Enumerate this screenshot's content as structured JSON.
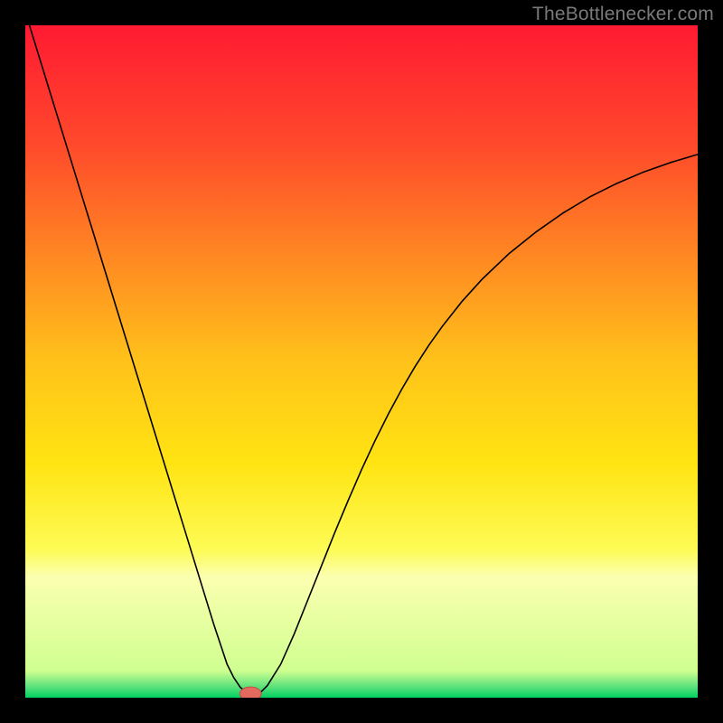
{
  "watermark": "TheBottlenecker.com",
  "chart_data": {
    "type": "line",
    "title": "",
    "xlabel": "",
    "ylabel": "",
    "xlim": [
      0,
      100
    ],
    "ylim": [
      0,
      100
    ],
    "grid": false,
    "legend": false,
    "background": {
      "type": "vertical-gradient",
      "stops": [
        {
          "offset": 0.0,
          "color": "#ff1a32"
        },
        {
          "offset": 0.18,
          "color": "#ff4a2b"
        },
        {
          "offset": 0.35,
          "color": "#ff8a22"
        },
        {
          "offset": 0.5,
          "color": "#ffc21a"
        },
        {
          "offset": 0.65,
          "color": "#ffe412"
        },
        {
          "offset": 0.78,
          "color": "#fdfb55"
        },
        {
          "offset": 0.82,
          "color": "#fbffb0"
        },
        {
          "offset": 0.96,
          "color": "#d0ff90"
        },
        {
          "offset": 0.985,
          "color": "#55e07a"
        },
        {
          "offset": 1.0,
          "color": "#00d060"
        }
      ]
    },
    "series": [
      {
        "name": "bottleneck-curve",
        "color": "#000000",
        "x": [
          0,
          2,
          4,
          6,
          8,
          10,
          12,
          14,
          16,
          18,
          20,
          22,
          24,
          26,
          28,
          30,
          31,
          32,
          33,
          34,
          35,
          36,
          38,
          40,
          42,
          44,
          46,
          48,
          50,
          52,
          54,
          56,
          58,
          60,
          62,
          65,
          68,
          72,
          76,
          80,
          84,
          88,
          92,
          96,
          100
        ],
        "y": [
          102,
          95.5,
          89,
          82.5,
          76,
          69.5,
          63,
          56.5,
          50,
          43.5,
          37,
          30.5,
          24,
          17.5,
          11,
          5,
          3,
          1.5,
          0.8,
          0.5,
          0.8,
          1.8,
          5,
          9.5,
          14.5,
          19.5,
          24.5,
          29.3,
          33.9,
          38.2,
          42.2,
          45.9,
          49.3,
          52.4,
          55.2,
          59.0,
          62.3,
          66.1,
          69.3,
          72.1,
          74.5,
          76.5,
          78.2,
          79.6,
          80.8
        ]
      }
    ],
    "marker": {
      "name": "optimal-marker",
      "x": 33.5,
      "y": 0.6,
      "rx": 1.6,
      "ry": 1.0,
      "fill": "#e46a60",
      "stroke": "#c04a40"
    }
  }
}
